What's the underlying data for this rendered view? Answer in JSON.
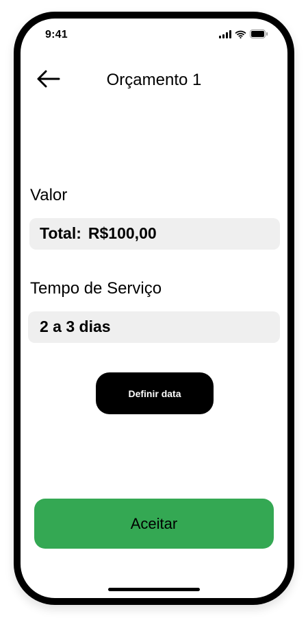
{
  "status_bar": {
    "time": "9:41",
    "icons": [
      "cellular-signal-icon",
      "wifi-icon",
      "battery-icon"
    ]
  },
  "header": {
    "back_icon": "arrow-left-icon",
    "title": "Orçamento 1"
  },
  "value_section": {
    "label": "Valor",
    "total_label": "Total:",
    "total_value": "R$100,00"
  },
  "service_time_section": {
    "label": "Tempo de Serviço",
    "value": "2 a 3 dias"
  },
  "buttons": {
    "define_date": "Definir data",
    "accept": "Aceitar"
  },
  "colors": {
    "accept_button": "#34a853",
    "field_background": "#efefef",
    "define_button": "#000000"
  }
}
